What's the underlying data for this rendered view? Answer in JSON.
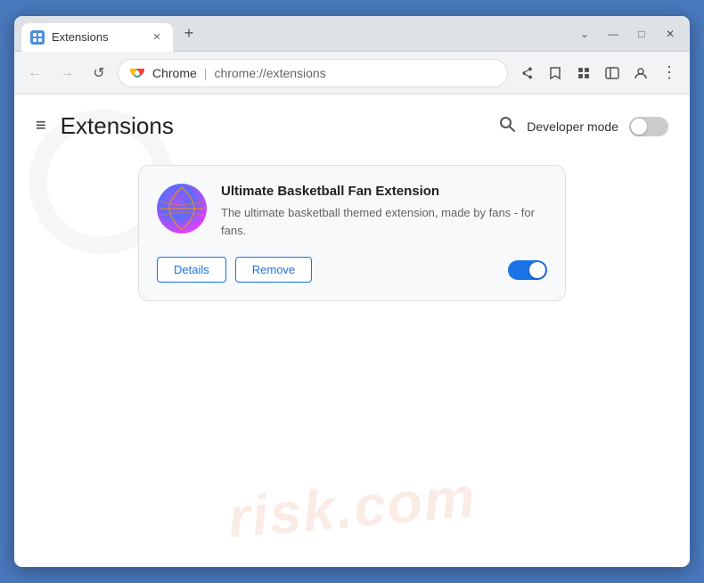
{
  "browser": {
    "tab_title": "Extensions",
    "tab_favicon": "puzzle",
    "new_tab_label": "+",
    "window_controls": {
      "chevron_down": "⌄",
      "minimize": "—",
      "maximize": "□",
      "close": "✕"
    }
  },
  "toolbar": {
    "back_label": "←",
    "forward_label": "→",
    "reload_label": "↺",
    "address_domain": "Chrome",
    "address_path": "chrome://extensions",
    "share_icon": "share",
    "star_icon": "☆",
    "extensions_icon": "puzzle",
    "sidebar_icon": "sidebar",
    "profile_icon": "person",
    "menu_icon": "⋮"
  },
  "page": {
    "hamburger_label": "≡",
    "title": "Extensions",
    "search_label": "🔍",
    "developer_mode_label": "Developer mode",
    "developer_mode_on": false
  },
  "extension": {
    "name": "Ultimate Basketball Fan Extension",
    "description": "The ultimate basketball themed extension, made by fans - for fans.",
    "details_label": "Details",
    "remove_label": "Remove",
    "enabled": true
  },
  "watermark": {
    "text": "risk.com"
  }
}
